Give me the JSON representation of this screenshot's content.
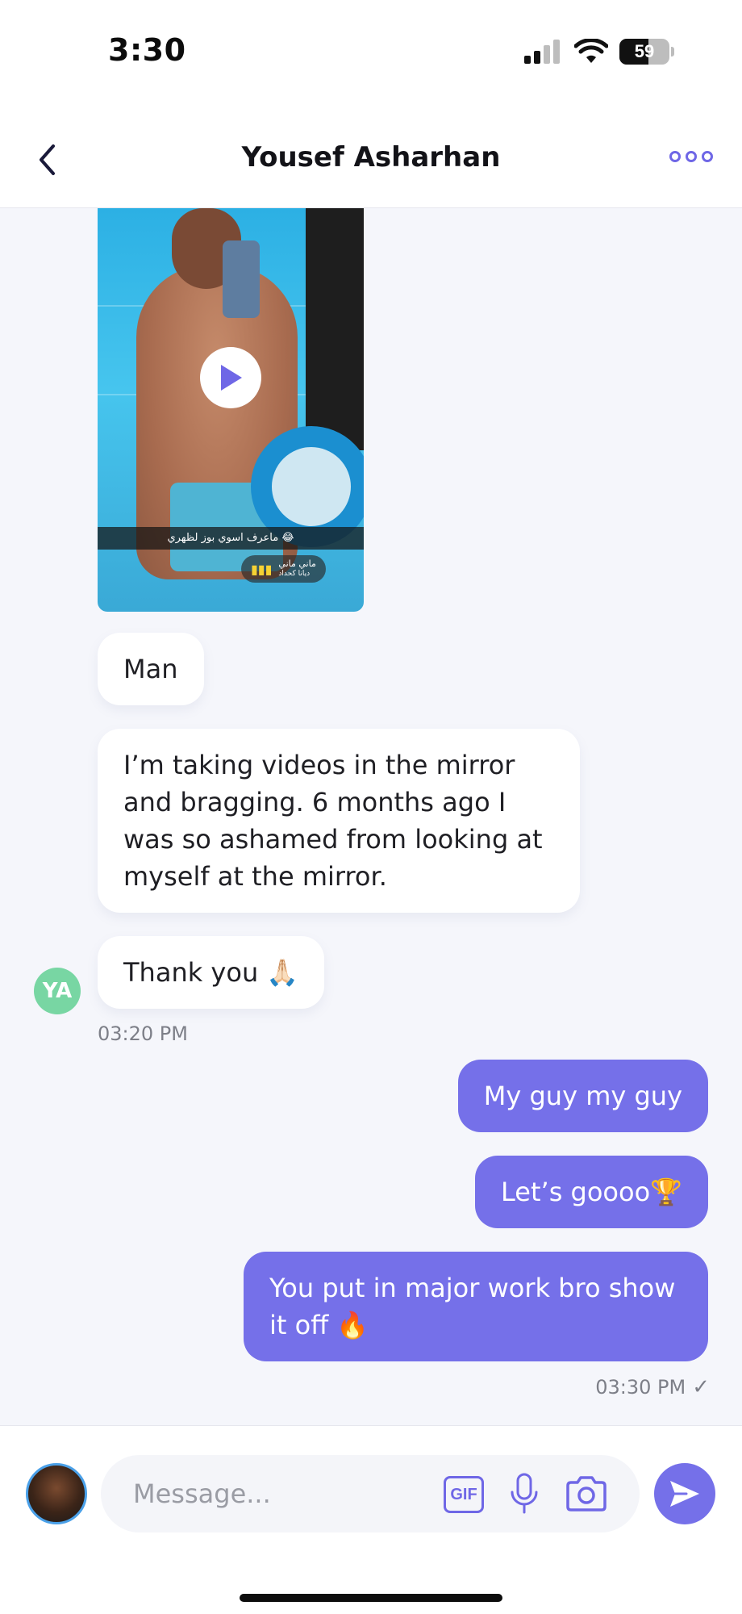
{
  "status_bar": {
    "time": "3:30",
    "battery": "59",
    "icons": [
      "cellular-signal-icon",
      "wifi-icon",
      "battery-icon"
    ]
  },
  "header": {
    "title": "Yousef Asharhan",
    "back_icon": "chevron-left-icon",
    "more_icon": "more-options-icon"
  },
  "video_message": {
    "caption": "ماعرف اسوي بوز لظهري 😂",
    "music_title": "ماني ماني",
    "music_artist": "ديانا كحداد",
    "play_icon": "play-icon"
  },
  "messages_incoming": [
    {
      "text": "Man"
    },
    {
      "text": "I’m taking videos in the mirror and bragging. 6 months ago I was so ashamed from looking at myself at the mirror."
    },
    {
      "text": "Thank you 🙏🏻"
    }
  ],
  "incoming_avatar": "YA",
  "incoming_timestamp": "03:20 PM",
  "messages_outgoing": [
    {
      "text": "My guy my guy"
    },
    {
      "text": "Let’s goooo🏆"
    },
    {
      "text": "You put in major work bro show it off 🔥"
    }
  ],
  "outgoing_timestamp": "03:30 PM",
  "composer": {
    "placeholder": "Message...",
    "gif_label": "GIF",
    "icons": [
      "microphone-icon",
      "camera-icon",
      "send-icon"
    ]
  },
  "colors": {
    "accent": "#7570e9",
    "incoming_bubble": "#ffffff",
    "background": "#f5f6fb",
    "avatar_ya": "#78d6a3"
  }
}
